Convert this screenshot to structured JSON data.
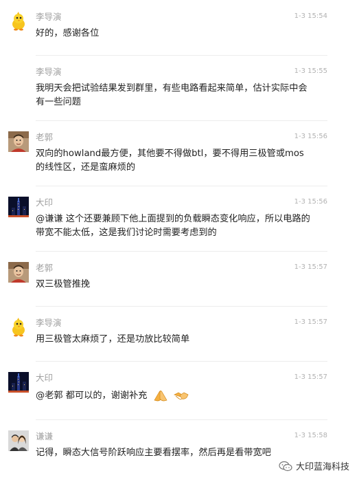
{
  "messages": [
    {
      "sender": "李导演",
      "time": "1-3 15:54",
      "text": "好的，感谢各位",
      "avatar": "chick-avatar"
    },
    {
      "sender": "李导演",
      "time": "1-3 15:55",
      "text": "我明天会把试验结果发到群里，有些电路看起来简单，估计实际中会有一些问题",
      "avatar": "none"
    },
    {
      "sender": "老郭",
      "time": "1-3 15:56",
      "text": "双向的howland最方便，其他要不得做btl，要不得用三极管或mos的线性区，还是蛮麻烦的",
      "avatar": "man-avatar"
    },
    {
      "sender": "大印",
      "time": "1-3 15:56",
      "text": "@谦谦 这个还要兼顾下他上面提到的负载瞬态变化响应，所以电路的带宽不能太低，这是我们讨论时需要考虑到的",
      "avatar": "city-night-avatar"
    },
    {
      "sender": "老郭",
      "time": "1-3 15:57",
      "text": "双三极管推挽",
      "avatar": "man-avatar"
    },
    {
      "sender": "李导演",
      "time": "1-3 15:57",
      "text": "用三极管太麻烦了，还是功放比较简单",
      "avatar": "chick-avatar"
    },
    {
      "sender": "大印",
      "time": "1-3 15:57",
      "text": "@老郭 都可以的，谢谢补充",
      "avatar": "city-night-avatar",
      "emojis": [
        "praying-hands-emoji",
        "handshake-emoji"
      ]
    },
    {
      "sender": "谦谦",
      "time": "1-3 15:58",
      "text": "记得，瞬态大信号阶跃响应主要看摆率，然后再是看带宽吧",
      "avatar": "couple-photo-avatar"
    }
  ],
  "watermark": {
    "text": "大印蓝海科技",
    "icon": "wechat-icon"
  }
}
